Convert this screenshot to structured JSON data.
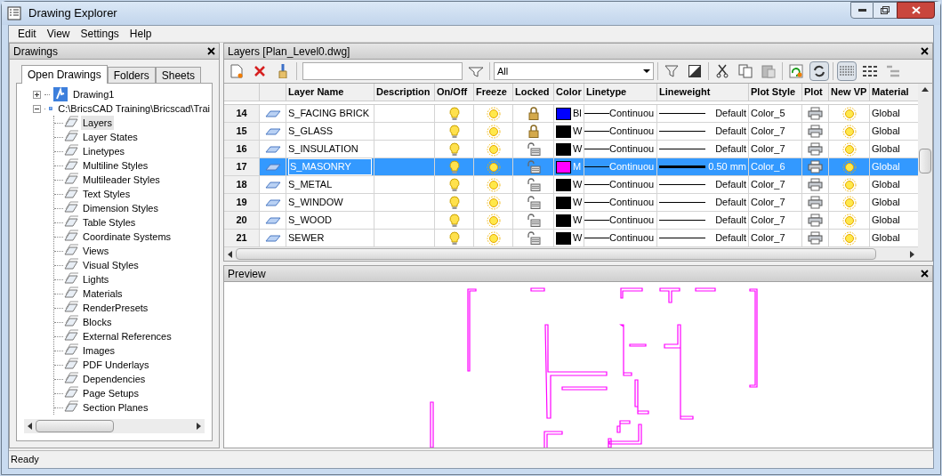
{
  "window": {
    "title": "Drawing Explorer"
  },
  "menu": [
    "Edit",
    "View",
    "Settings",
    "Help"
  ],
  "drawings_panel": {
    "title": "Drawings",
    "tabs": [
      {
        "label": "Open Drawings",
        "selected": true
      },
      {
        "label": "Folders",
        "selected": false
      },
      {
        "label": "Sheets",
        "selected": false
      }
    ],
    "tree": [
      {
        "label": "Drawing1",
        "expanded": false,
        "selected": false
      },
      {
        "label": "C:\\BricsCAD Training\\Bricscad\\Trai",
        "expanded": true,
        "selected": false,
        "children": [
          {
            "label": "Layers",
            "selected": true
          },
          {
            "label": "Layer States",
            "selected": false
          },
          {
            "label": "Linetypes",
            "selected": false
          },
          {
            "label": "Multiline Styles",
            "selected": false
          },
          {
            "label": "Multileader Styles",
            "selected": false
          },
          {
            "label": "Text Styles",
            "selected": false
          },
          {
            "label": "Dimension Styles",
            "selected": false
          },
          {
            "label": "Table Styles",
            "selected": false
          },
          {
            "label": "Coordinate Systems",
            "selected": false
          },
          {
            "label": "Views",
            "selected": false
          },
          {
            "label": "Visual Styles",
            "selected": false
          },
          {
            "label": "Lights",
            "selected": false
          },
          {
            "label": "Materials",
            "selected": false
          },
          {
            "label": "RenderPresets",
            "selected": false
          },
          {
            "label": "Blocks",
            "selected": false
          },
          {
            "label": "External References",
            "selected": false
          },
          {
            "label": "Images",
            "selected": false
          },
          {
            "label": "PDF Underlays",
            "selected": false
          },
          {
            "label": "Dependencies",
            "selected": false
          },
          {
            "label": "Page Setups",
            "selected": false
          },
          {
            "label": "Section Planes",
            "selected": false
          }
        ]
      }
    ]
  },
  "layers_panel": {
    "title": "Layers [Plan_Level0.dwg]",
    "filter_dropdown": "All",
    "columns": [
      "Layer Name",
      "Description",
      "On/Off",
      "Freeze",
      "Locked",
      "Color",
      "Linetype",
      "Lineweight",
      "Plot Style",
      "Plot",
      "New VP",
      "Material"
    ],
    "rows": [
      {
        "number": "14",
        "name": "S_FACING BRICK",
        "on": true,
        "frozen": false,
        "locked": true,
        "color": "#0000ff",
        "color_label": "Bl",
        "linetype": "Continuou",
        "lineweight": "Default",
        "thick": false,
        "plot_style": "Color_5",
        "plot": true,
        "new_vp_frozen": false,
        "material": "Global",
        "selected": false
      },
      {
        "number": "15",
        "name": "S_GLASS",
        "on": true,
        "frozen": false,
        "locked": true,
        "color": "#000000",
        "color_label": "W",
        "linetype": "Continuou",
        "lineweight": "Default",
        "thick": false,
        "plot_style": "Color_7",
        "plot": true,
        "new_vp_frozen": false,
        "material": "Global",
        "selected": false
      },
      {
        "number": "16",
        "name": "S_INSULATION",
        "on": true,
        "frozen": false,
        "locked": false,
        "color": "#000000",
        "color_label": "W",
        "linetype": "Continuou",
        "lineweight": "Default",
        "thick": false,
        "plot_style": "Color_7",
        "plot": true,
        "new_vp_frozen": false,
        "material": "Global",
        "selected": false
      },
      {
        "number": "17",
        "name": "S_MASONRY",
        "on": true,
        "frozen": false,
        "locked": false,
        "color": "#ff00ff",
        "color_label": "M",
        "linetype": "Continuou",
        "lineweight": "0.50 mm",
        "thick": true,
        "plot_style": "Color_6",
        "plot": true,
        "new_vp_frozen": false,
        "material": "Global",
        "selected": true
      },
      {
        "number": "18",
        "name": "S_METAL",
        "on": true,
        "frozen": false,
        "locked": false,
        "color": "#000000",
        "color_label": "W",
        "linetype": "Continuou",
        "lineweight": "Default",
        "thick": false,
        "plot_style": "Color_7",
        "plot": true,
        "new_vp_frozen": false,
        "material": "Global",
        "selected": false
      },
      {
        "number": "19",
        "name": "S_WINDOW",
        "on": true,
        "frozen": false,
        "locked": false,
        "color": "#000000",
        "color_label": "W",
        "linetype": "Continuou",
        "lineweight": "Default",
        "thick": false,
        "plot_style": "Color_7",
        "plot": true,
        "new_vp_frozen": false,
        "material": "Global",
        "selected": false
      },
      {
        "number": "20",
        "name": "S_WOOD",
        "on": true,
        "frozen": false,
        "locked": false,
        "color": "#000000",
        "color_label": "W",
        "linetype": "Continuou",
        "lineweight": "Default",
        "thick": false,
        "plot_style": "Color_7",
        "plot": true,
        "new_vp_frozen": false,
        "material": "Global",
        "selected": false
      },
      {
        "number": "21",
        "name": "SEWER",
        "on": true,
        "frozen": false,
        "locked": false,
        "color": "#000000",
        "color_label": "W",
        "linetype": "Continuou",
        "lineweight": "Default",
        "thick": false,
        "plot_style": "Color_7",
        "plot": true,
        "new_vp_frozen": false,
        "material": "Global",
        "selected": false
      }
    ]
  },
  "preview_panel": {
    "title": "Preview"
  },
  "status_bar": "Ready"
}
